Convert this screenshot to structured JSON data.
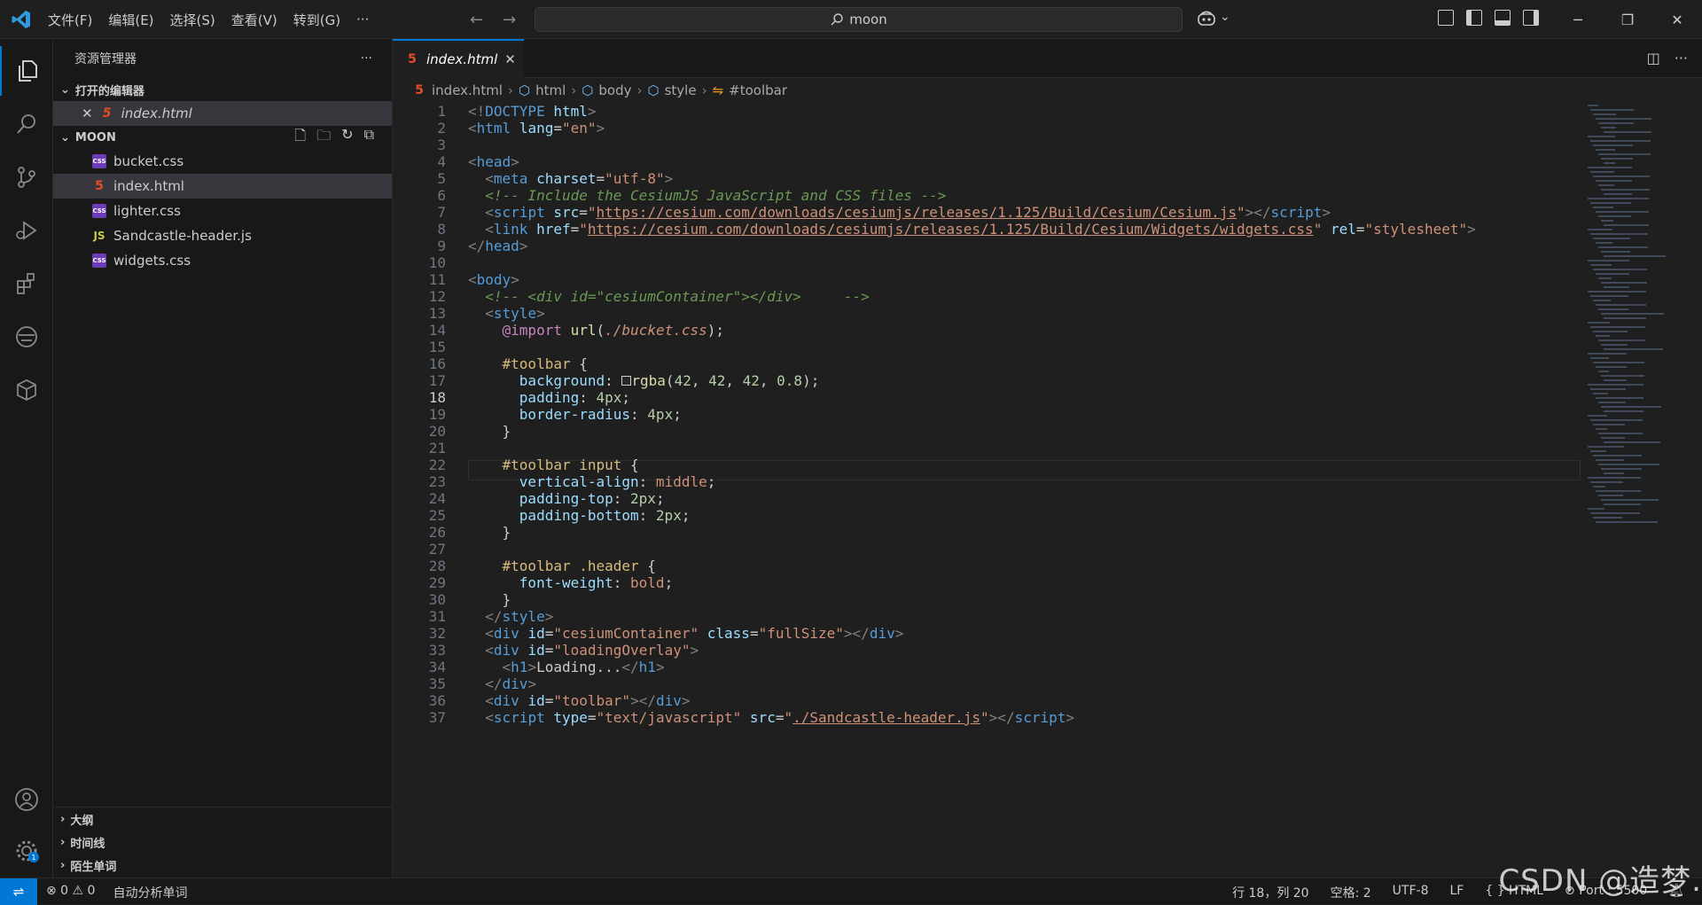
{
  "menu": [
    "文件(F)",
    "编辑(E)",
    "选择(S)",
    "查看(V)",
    "转到(G)",
    "···"
  ],
  "search": {
    "placeholder": "moon"
  },
  "window_controls": [
    "─",
    "❐",
    "✕"
  ],
  "sidebar": {
    "title": "资源管理器",
    "more": "···",
    "open_editors_label": "打开的编辑器",
    "open_editors": [
      {
        "name": "index.html"
      }
    ],
    "folder_label": "MOON",
    "files": [
      {
        "name": "bucket.css",
        "type": "css"
      },
      {
        "name": "index.html",
        "type": "html"
      },
      {
        "name": "lighter.css",
        "type": "css"
      },
      {
        "name": "Sandcastle-header.js",
        "type": "js"
      },
      {
        "name": "widgets.css",
        "type": "css"
      }
    ],
    "bottom_sections": [
      "大纲",
      "时间线",
      "陌生单词"
    ]
  },
  "tab": {
    "label": "index.html"
  },
  "breadcrumb": [
    "index.html",
    "html",
    "body",
    "style",
    "#toolbar"
  ],
  "editor": {
    "current_line": 18,
    "lines": [
      "1",
      "2",
      "3",
      "4",
      "5",
      "6",
      "7",
      "8",
      "9",
      "10",
      "11",
      "12",
      "13",
      "14",
      "15",
      "16",
      "17",
      "18",
      "19",
      "20",
      "21",
      "22",
      "23",
      "24",
      "25",
      "26",
      "27",
      "28",
      "29",
      "30",
      "31",
      "32",
      "33",
      "34",
      "35",
      "36",
      "37"
    ]
  },
  "status": {
    "problems": "⊗ 0 ⚠ 0",
    "extension": "自动分析单词",
    "position": "行 18，列 20",
    "spaces": "空格: 2",
    "encoding": "UTF-8",
    "eol": "LF",
    "language": "{ } HTML",
    "port": "⊘ Port : 5500"
  },
  "watermark": "CSDN @造梦."
}
